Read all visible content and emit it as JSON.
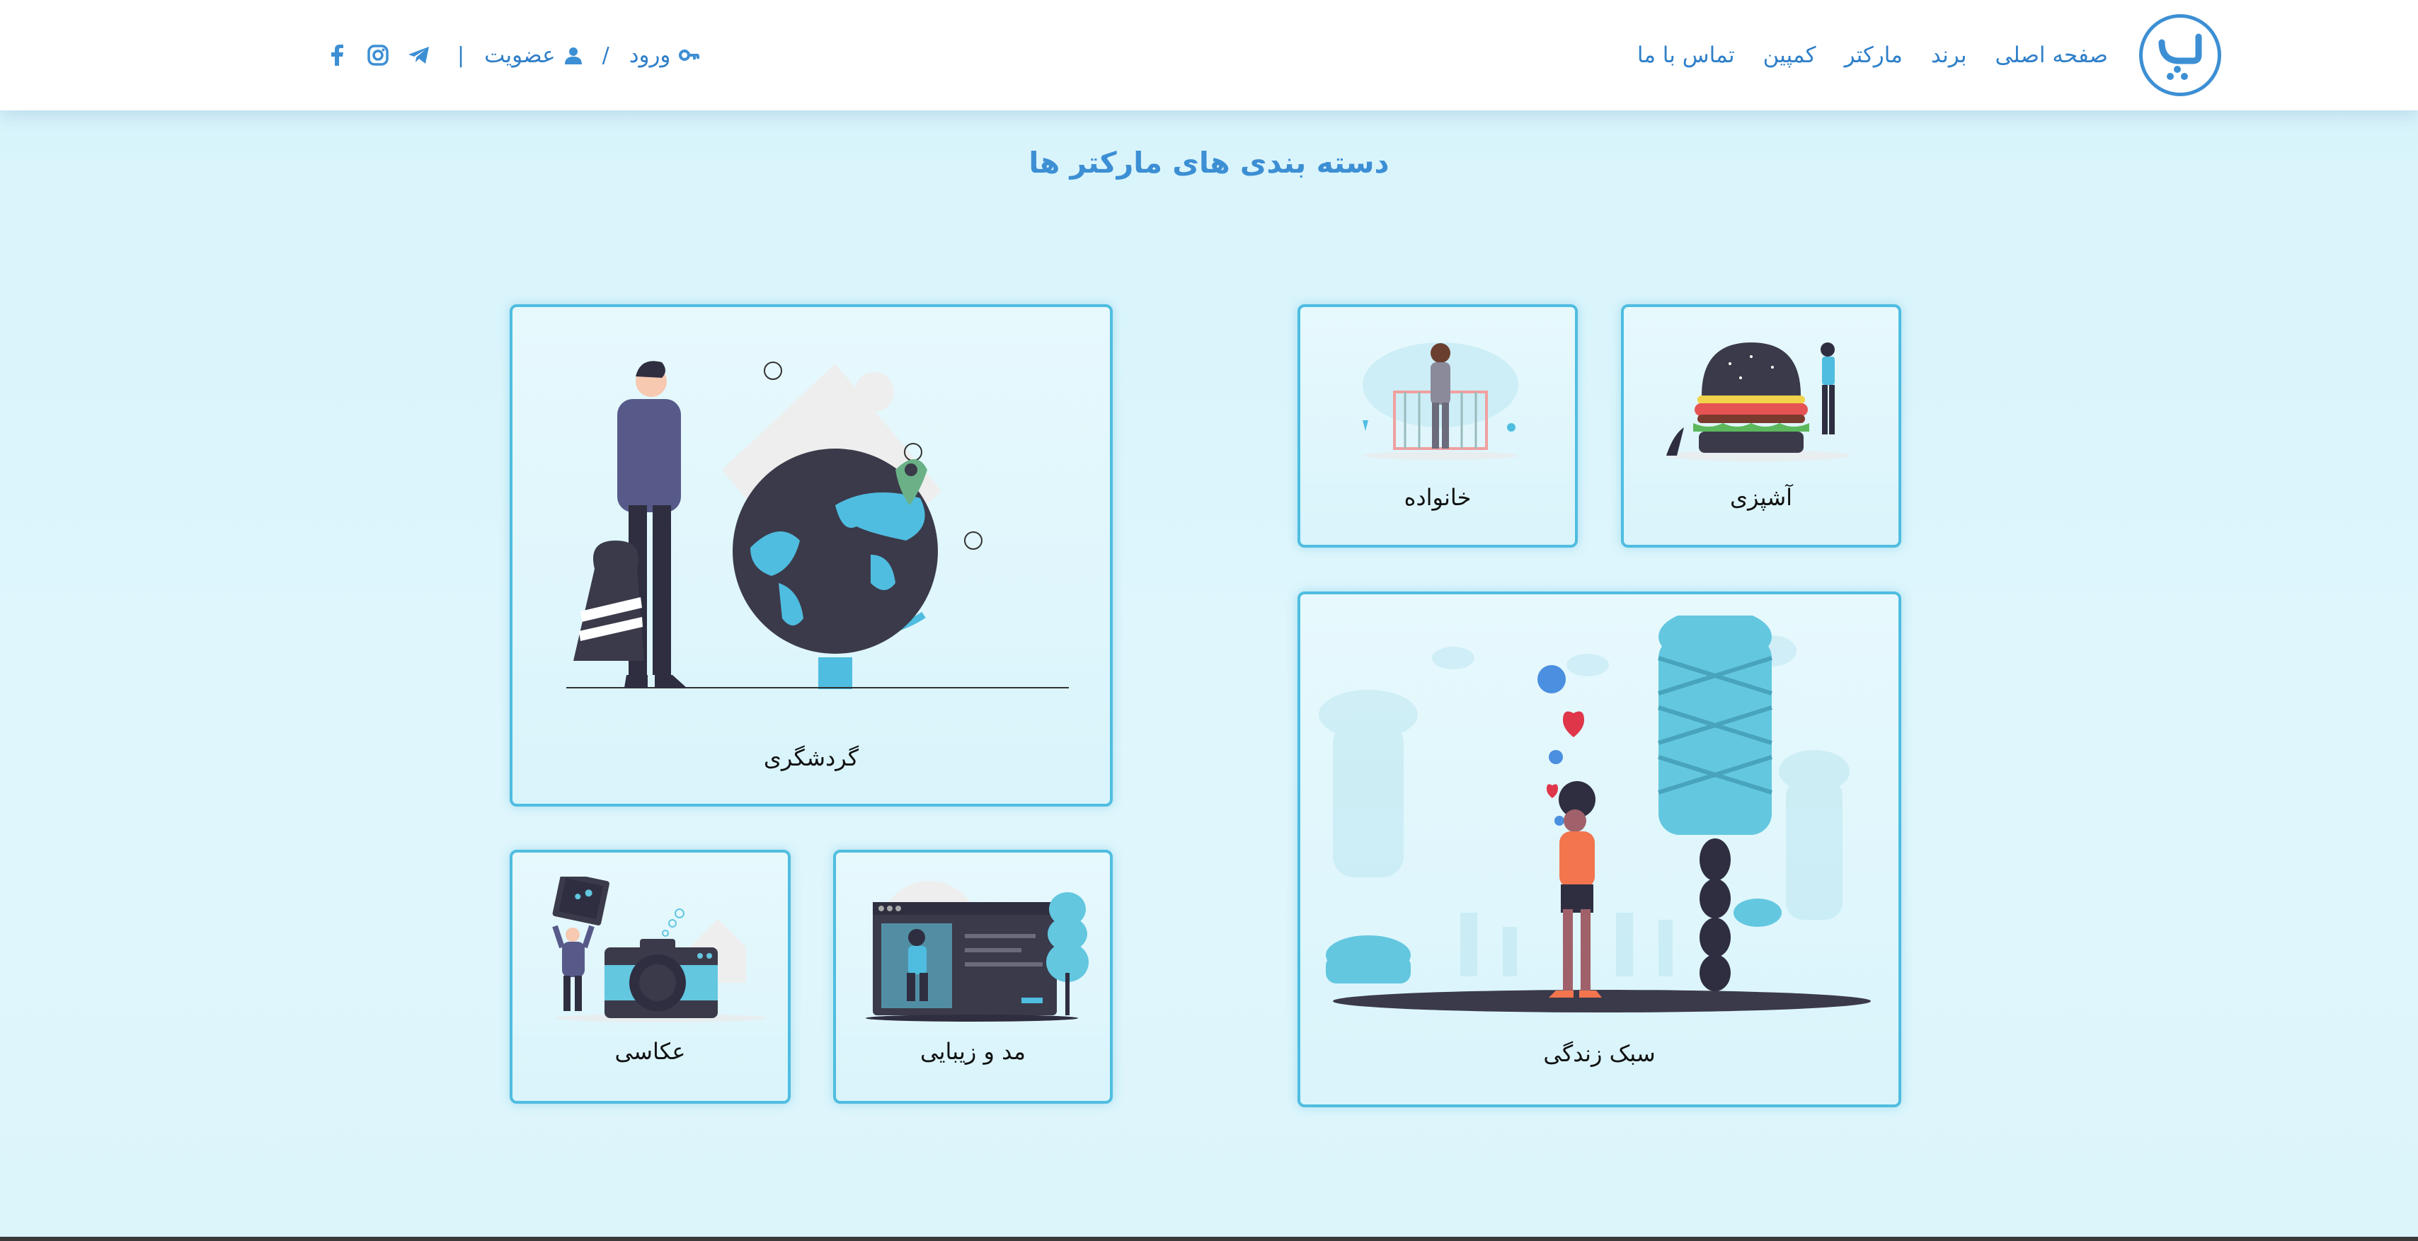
{
  "header": {
    "logo_label": "پ",
    "nav": [
      "صفحه اصلی",
      "برند",
      "مارکتر",
      "کمپین",
      "تماس با ما"
    ],
    "login_label": "ورود",
    "signup_label": "عضویت",
    "slash": "/",
    "separator": "|",
    "social_icons": [
      "instagram-icon",
      "telegram-icon",
      "facebook-icon"
    ]
  },
  "page": {
    "title": "دسته بندی های مارکتر ها"
  },
  "categories": [
    {
      "label": "آشپزی",
      "icon": "burger-illustration"
    },
    {
      "label": "خانواده",
      "icon": "family-illustration"
    },
    {
      "label": "گردشگری",
      "icon": "globe-traveler-illustration"
    },
    {
      "label": "سبک زندگی",
      "icon": "lifestyle-illustration"
    },
    {
      "label": "مد و زیبایی",
      "icon": "fashion-illustration"
    },
    {
      "label": "عکاسی",
      "icon": "camera-illustration"
    }
  ],
  "colors": {
    "accent": "#3d8fd4",
    "card_border": "#4fbde0",
    "background": "#dff6fc"
  }
}
